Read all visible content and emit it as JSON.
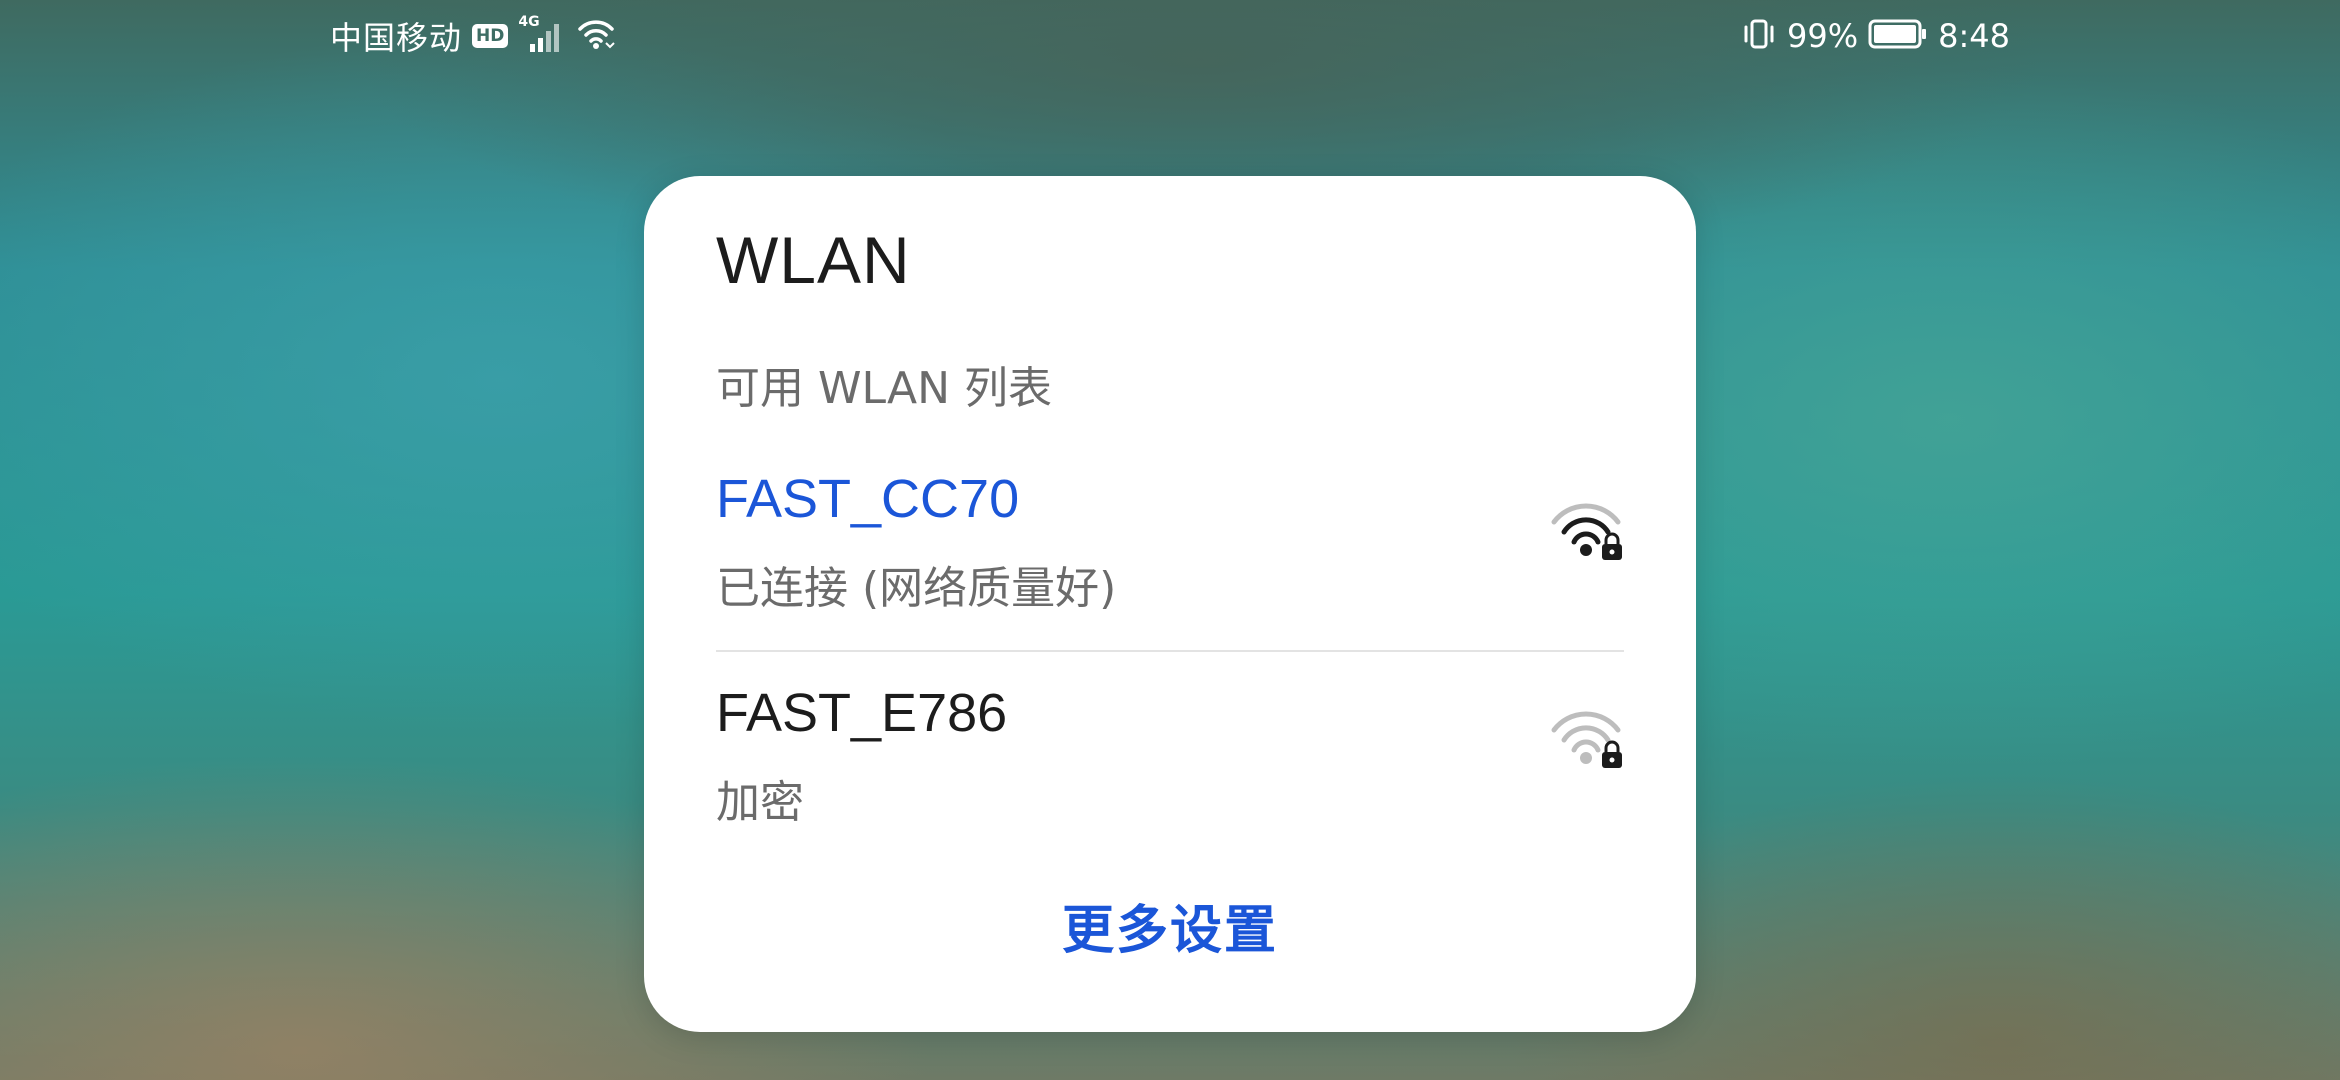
{
  "status_bar": {
    "carrier": "中国移动",
    "hd_label": "HD",
    "network_type": "4G",
    "battery_percent": "99%",
    "time": "8:48",
    "icons": [
      "signal-icon",
      "wifi-icon",
      "vibrate-icon",
      "battery-icon"
    ]
  },
  "dialog": {
    "title": "WLAN",
    "subtitle": "可用 WLAN 列表",
    "networks": [
      {
        "name": "FAST_CC70",
        "status": "已连接 (网络质量好)",
        "connected": true,
        "icon": "wifi-lock-icon"
      },
      {
        "name": "FAST_E786",
        "status": "加密",
        "connected": false,
        "icon": "wifi-lock-icon"
      }
    ],
    "more_settings_label": "更多设置"
  },
  "colors": {
    "accent": "#1b56d8",
    "text_primary": "#1c1c1c",
    "text_secondary": "#6b6b6b"
  }
}
